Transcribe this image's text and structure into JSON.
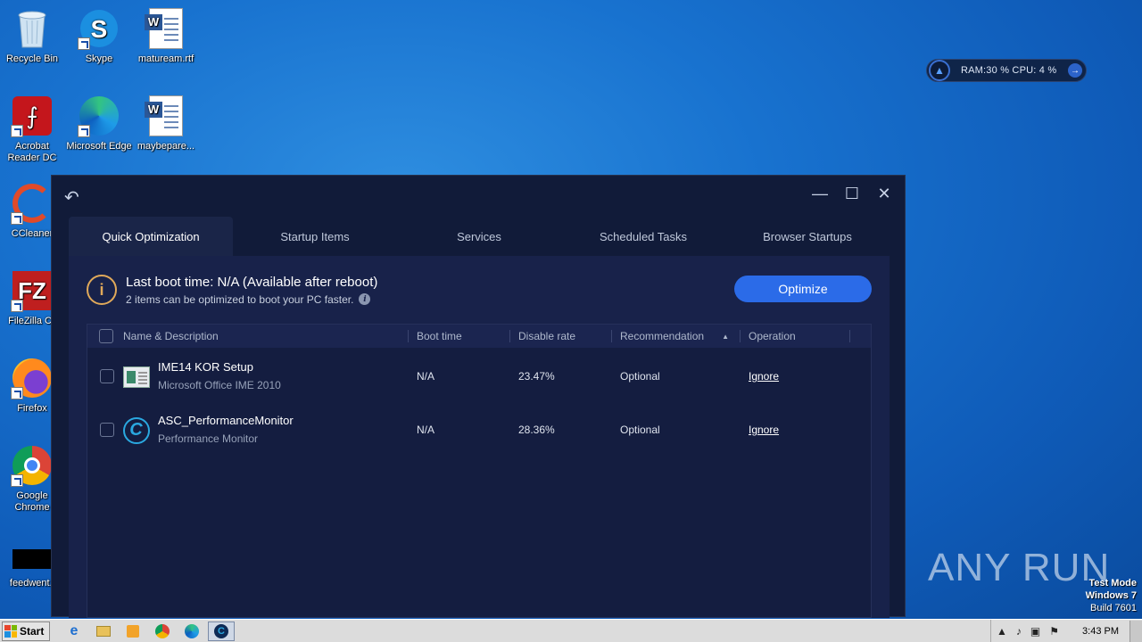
{
  "desktop": {
    "icons": [
      {
        "label": "Recycle Bin",
        "icon": "recycle-bin-icon"
      },
      {
        "label": "Skype",
        "icon": "skype-icon"
      },
      {
        "label": "matuream.rtf",
        "icon": "word-document-icon"
      },
      {
        "label": "Acrobat Reader DC",
        "icon": "acrobat-icon"
      },
      {
        "label": "Microsoft Edge",
        "icon": "edge-icon"
      },
      {
        "label": "maybepare...",
        "icon": "word-document-icon"
      },
      {
        "label": "CCleaner",
        "icon": "ccleaner-icon"
      },
      {
        "label": "FileZilla Cli",
        "icon": "filezilla-icon"
      },
      {
        "label": "Firefox",
        "icon": "firefox-icon"
      },
      {
        "label": "Google Chrome",
        "icon": "chrome-icon"
      },
      {
        "label": "feedwent.j",
        "icon": "file-icon"
      }
    ]
  },
  "widget": {
    "text": "RAM:30 %   CPU: 4 %"
  },
  "window": {
    "tabs": [
      "Quick Optimization",
      "Startup Items",
      "Services",
      "Scheduled Tasks",
      "Browser Startups"
    ],
    "info": {
      "title": "Last boot time: N/A (Available after reboot)",
      "count": "2",
      "subtitle": " items can be optimized to boot your PC faster."
    },
    "optimize_label": "Optimize",
    "table": {
      "headers": [
        "Name & Description",
        "Boot time",
        "Disable rate",
        "Recommendation",
        "Operation"
      ],
      "rows": [
        {
          "name": "IME14 KOR Setup",
          "description": "Microsoft Office IME 2010",
          "boot_time": "N/A",
          "disable_rate": "23.47%",
          "recommendation": "Optional",
          "operation": "Ignore"
        },
        {
          "name": "ASC_PerformanceMonitor",
          "description": "Performance Monitor",
          "boot_time": "N/A",
          "disable_rate": "28.36%",
          "recommendation": "Optional",
          "operation": "Ignore"
        }
      ]
    }
  },
  "watermark": {
    "text": "ANY RUN"
  },
  "testmode": {
    "line1": "Test Mode",
    "line2": "Windows 7",
    "line3": "Build 7601"
  },
  "taskbar": {
    "start_label": "Start",
    "clock": "3:43 PM"
  },
  "colors": {
    "accent": "#2b6be8",
    "window_bg": "#111b39",
    "panel_bg": "#18224a",
    "warning": "#e0a95a"
  }
}
